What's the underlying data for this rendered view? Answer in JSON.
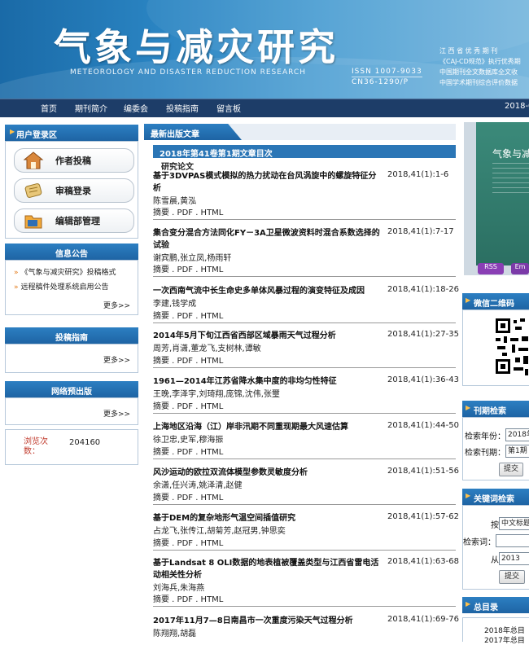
{
  "header": {
    "title": "气象与减灾研究",
    "subtitle_en": "METEOROLOGY AND DISASTER REDUCTION RESEARCH",
    "issn": "ISSN 1007-9033",
    "cn": "CN36-1290/P",
    "honors": [
      "江 西 省 优 秀 期 刊",
      "《CAJ-CD规范》执行优秀期",
      "中国期刊全文数据库全文收",
      "中国学术期刊综合评价数据"
    ]
  },
  "nav": {
    "items": [
      "首页",
      "期刊简介",
      "编委会",
      "投稿指南",
      "留言板"
    ],
    "date": "2018-0"
  },
  "login": {
    "heading": "用户登录区",
    "buttons": [
      "作者投稿",
      "审稿登录",
      "编辑部管理"
    ]
  },
  "notices": {
    "heading": "信息公告",
    "items": [
      "《气象与减灾研究》投稿格式",
      "远程稿件处理系统启用公告"
    ],
    "more": "更多>>"
  },
  "guide": {
    "heading": "投稿指南",
    "more": "更多>>"
  },
  "preprint": {
    "heading": "网络预出版",
    "more": "更多>>"
  },
  "visits": {
    "label": "浏览次数：",
    "count": "204160"
  },
  "latest": {
    "heading": "最新出版文章",
    "issue": "2018年第41卷第1期文章目次",
    "section": "研究论文",
    "articles": [
      {
        "title": "基于3DVPAS模式模拟的热力扰动在台风涡旋中的螺旋特征分析",
        "ref": "2018,41(1):1-6",
        "authors": "陈雪晨,黄泓",
        "links": "摘要 . PDF . HTML"
      },
      {
        "title": "集合变分混合方法同化FY－3A卫星微波资料时混合系数选择的试验",
        "ref": "2018,41(1):7-17",
        "authors": "谢宾鹏,张立凤,杨雨轩",
        "links": "摘要 . PDF . HTML"
      },
      {
        "title": "一次西南气流中长生命史多单体风暴过程的演变特征及成因",
        "ref": "2018,41(1):18-26",
        "authors": "李建,钱学成",
        "links": "摘要 . PDF . HTML"
      },
      {
        "title": "2014年5月下旬江西省西部区域暴雨天气过程分析",
        "ref": "2018,41(1):27-35",
        "authors": "周芳,肖潇,董龙飞,支树林,谭敏",
        "links": "摘要 . PDF . HTML"
      },
      {
        "title": "1961—2014年江苏省降水集中度的非均匀性特征",
        "ref": "2018,41(1):36-43",
        "authors": "王晚,李泽宇,刘琦翔,庞锦,沈伟,张璽",
        "links": "摘要 . PDF . HTML"
      },
      {
        "title": "上海地区沿海（江）岸非汛期不同重现期最大风速估算",
        "ref": "2018,41(1):44-50",
        "authors": "徐卫忠,史军,穆海振",
        "links": "摘要 . PDF . HTML"
      },
      {
        "title": "风沙运动的欧拉双流体模型参数灵敏度分析",
        "ref": "2018,41(1):51-56",
        "authors": "余潇,任兴涛,姚泽清,赵健",
        "links": "摘要 . PDF . HTML"
      },
      {
        "title": "基于DEM的复杂地形气温空间插值研究",
        "ref": "2018,41(1):57-62",
        "authors": "占龙飞,张传江,胡菊芳,赵冠男,钟思奕",
        "links": "摘要 . PDF . HTML"
      },
      {
        "title": "基于Landsat 8 OLI数据的地表植被覆盖类型与江西省雷电活动相关性分析",
        "ref": "2018,41(1):63-68",
        "authors": "刘海兵,朱海燕",
        "links": "摘要 . PDF . HTML"
      },
      {
        "title": "2017年11月7—8日南昌市一次重度污染天气过程分析",
        "ref": "2018,41(1):69-76",
        "authors": "陈翔翔,胡磊",
        "links": ""
      }
    ]
  },
  "cover": {
    "title": "气象与减",
    "badges": [
      "RSS",
      "Em"
    ]
  },
  "wechat": {
    "heading": "微信二维码"
  },
  "issue_search": {
    "heading": "刊期检索",
    "year_label": "检索年份：",
    "year_value": "2018年",
    "issue_label": "检索刊期：",
    "issue_value": "第1期",
    "submit": "提交"
  },
  "keyword_search": {
    "heading": "关键词检索",
    "by_label": "按",
    "by_value": "中文标题",
    "keyword_label": "检索词：",
    "keyword_value": "",
    "from_label": "从",
    "from_value": "2013",
    "submit": "提交"
  },
  "catalog": {
    "heading": "总目录",
    "items": [
      "2018年总目",
      "2017年总目"
    ]
  },
  "colors": {
    "nav_bg": "#1d3d68",
    "heading_blue": "#1e64a4",
    "accent_orange": "#e37b1a",
    "visits_red": "#c0392b"
  }
}
